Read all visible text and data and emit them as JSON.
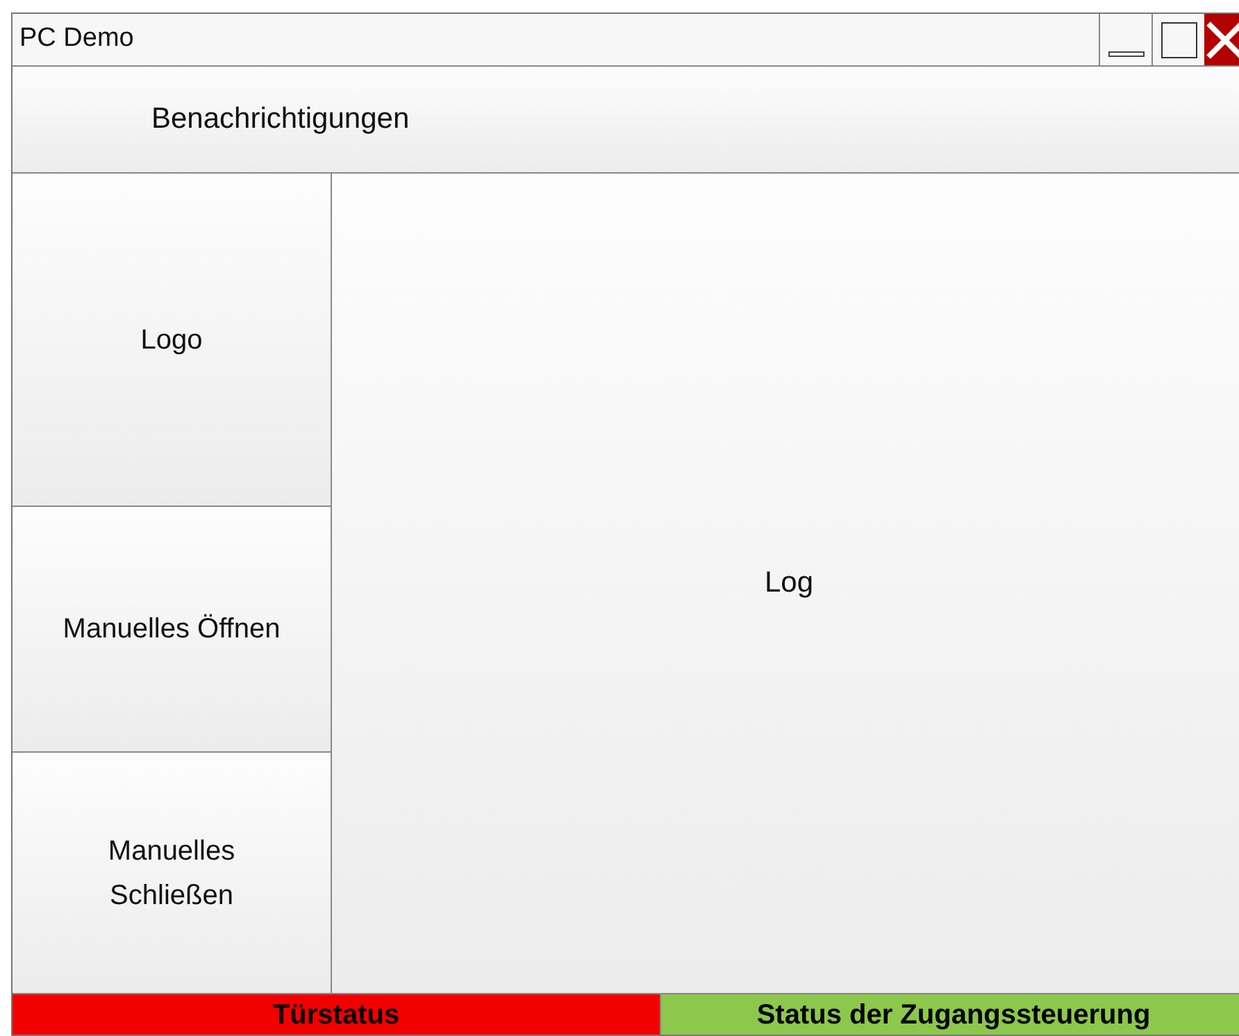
{
  "window": {
    "title": "PC Demo"
  },
  "header": {
    "label": "Benachrichtigungen"
  },
  "logo": {
    "label": "Logo"
  },
  "sidebar": {
    "buttons": [
      {
        "label": "Manuelles Öffnen"
      },
      {
        "label": "Manuelles Schließen"
      }
    ]
  },
  "log": {
    "label": "Log"
  },
  "status_bar": [
    {
      "label": "Türstatus",
      "color": "#f20000"
    },
    {
      "label": "Status der Zugangssteuerung",
      "color": "#8cc84b"
    }
  ]
}
